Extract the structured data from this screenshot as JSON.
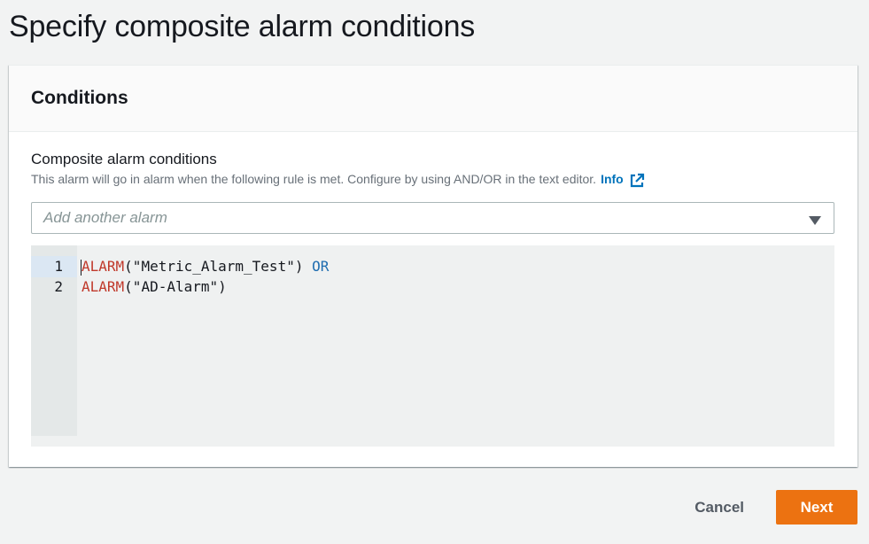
{
  "page": {
    "title": "Specify composite alarm conditions"
  },
  "panel": {
    "heading": "Conditions",
    "field_label": "Composite alarm conditions",
    "field_description": "This alarm will go in alarm when the following rule is met. Configure by using AND/OR in the text editor.",
    "info_link": "Info",
    "select": {
      "placeholder": "Add another alarm"
    },
    "editor": {
      "lines": [
        {
          "number": "1",
          "keyword": "ALARM",
          "args": "(\"Metric_Alarm_Test\")",
          "operator": "OR"
        },
        {
          "number": "2",
          "keyword": "ALARM",
          "args": "(\"AD-Alarm\")",
          "operator": ""
        }
      ]
    }
  },
  "actions": {
    "cancel_label": "Cancel",
    "next_label": "Next"
  },
  "colors": {
    "primary_button": "#ec7211",
    "link": "#0073bb",
    "keyword": "#c0392b",
    "operator": "#1f6db0"
  },
  "icons": {
    "external_link": "external-link-icon",
    "dropdown": "caret-down-icon"
  }
}
